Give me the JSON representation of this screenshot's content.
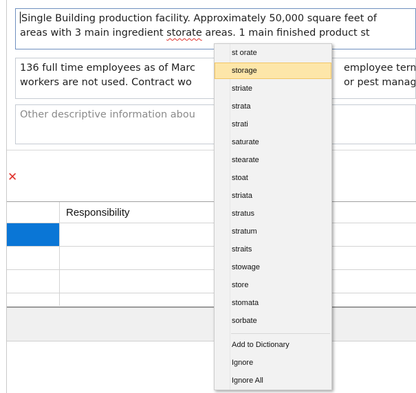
{
  "fields": {
    "line1a": "Single Building production facility.  Approximately 50,000 square feet of",
    "line1b_pre": "areas with 3 main ingredient ",
    "line1b_misspelled": "storate",
    "line1b_post": " areas.  1 main finished product st",
    "line2a": "136 full time employees as of Marc",
    "line2a_right": "employee term",
    "line2b": "workers are not used.  Contract wo",
    "line2b_right": "or pest manag",
    "placeholder": "Other descriptive information abou"
  },
  "toolbar": {
    "close_symbol": "✕"
  },
  "grid": {
    "header": "Responsibility",
    "row_count": 4
  },
  "context_menu": {
    "suggestions": [
      "st orate",
      "storage",
      "striate",
      "strata",
      "strati",
      "saturate",
      "stearate",
      "stoat",
      "striata",
      "stratus",
      "stratum",
      "straits",
      "stowage",
      "store",
      "stomata",
      "sorbate"
    ],
    "highlighted": "storage",
    "add_to_dictionary": "Add to Dictionary",
    "ignore": "Ignore",
    "ignore_all": "Ignore All"
  },
  "colors": {
    "selection": "#0a76d6",
    "menu_highlight": "#fde6a9",
    "spell_error": "#e0312b"
  }
}
